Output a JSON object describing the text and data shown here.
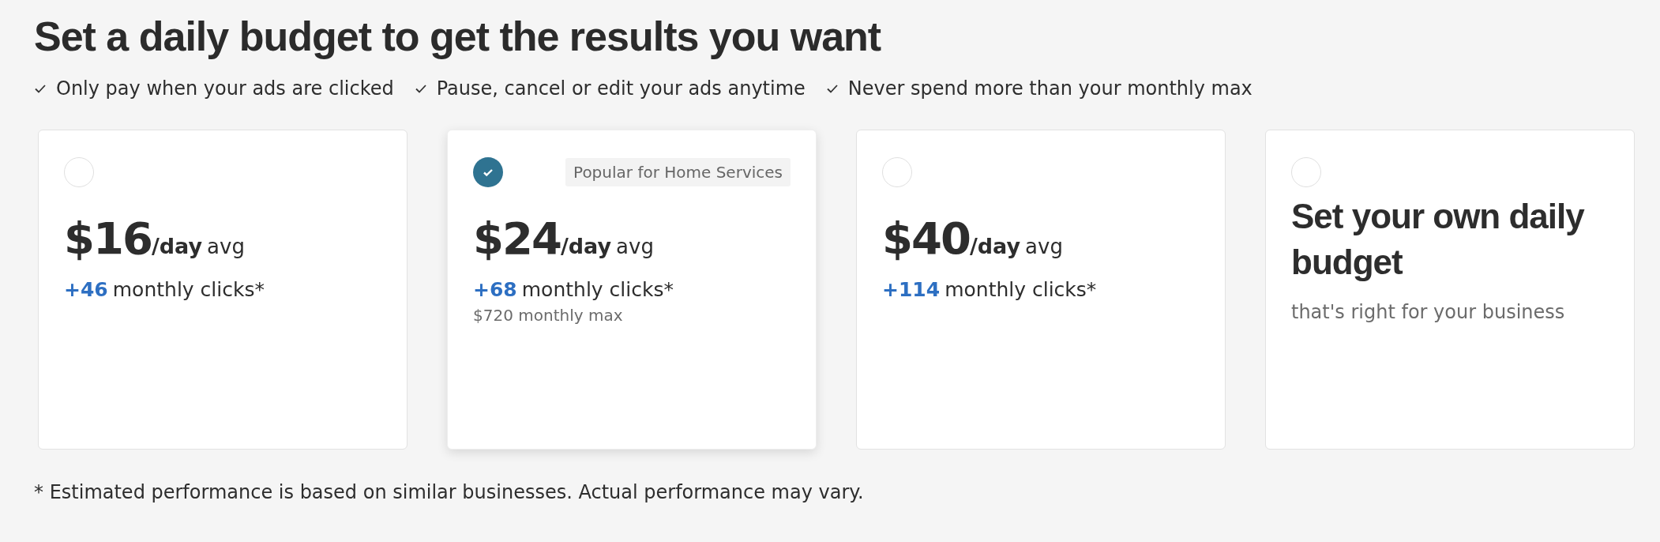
{
  "title": "Set a daily budget to get the results you want",
  "benefits": [
    "Only pay when your ads are clicked",
    "Pause, cancel or edit your ads anytime",
    "Never spend more than your monthly max"
  ],
  "options": [
    {
      "kind": "preset",
      "selected": false,
      "amount": "$16",
      "unit": "/day",
      "suffix": "avg",
      "clicks_count": "+46",
      "clicks_label": "monthly clicks*"
    },
    {
      "kind": "preset",
      "selected": true,
      "badge": "Popular for Home Services",
      "amount": "$24",
      "unit": "/day",
      "suffix": "avg",
      "clicks_count": "+68",
      "clicks_label": "monthly clicks*",
      "max": "$720 monthly max"
    },
    {
      "kind": "preset",
      "selected": false,
      "amount": "$40",
      "unit": "/day",
      "suffix": "avg",
      "clicks_count": "+114",
      "clicks_label": "monthly clicks*"
    },
    {
      "kind": "custom",
      "selected": false,
      "heading": "Set your own daily budget",
      "subtext": "that's right for your business"
    }
  ],
  "footnote": "* Estimated performance is based on similar businesses. Actual performance may vary."
}
